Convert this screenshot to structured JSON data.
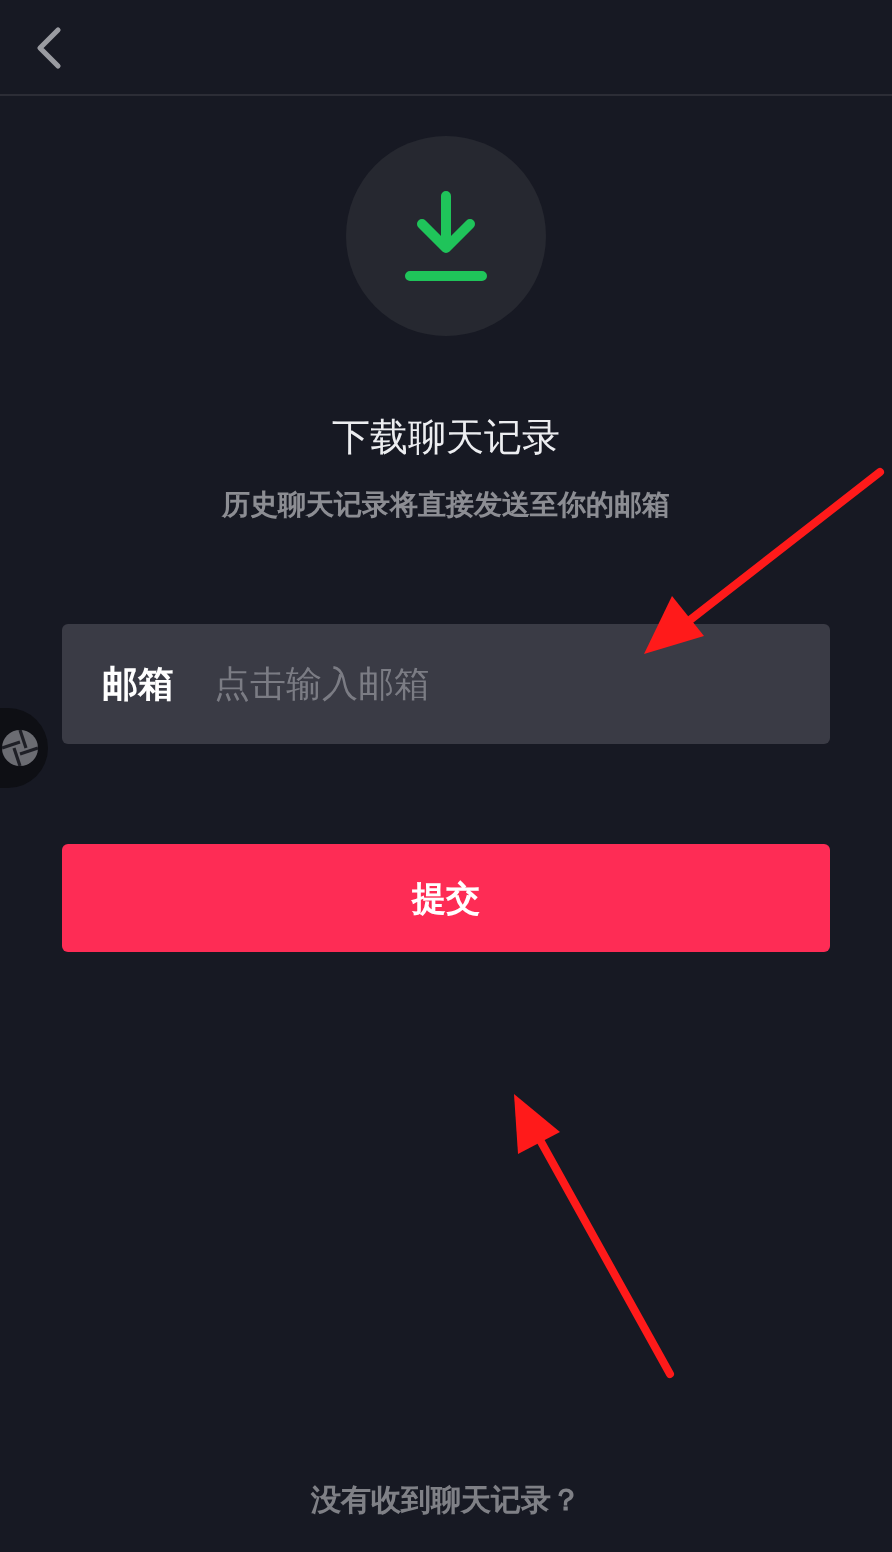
{
  "title": "下载聊天记录",
  "subtitle": "历史聊天记录将直接发送至你的邮箱",
  "email_field": {
    "label": "邮箱",
    "placeholder": "点击输入邮箱"
  },
  "submit_button": "提交",
  "footer_link": "没有收到聊天记录？"
}
